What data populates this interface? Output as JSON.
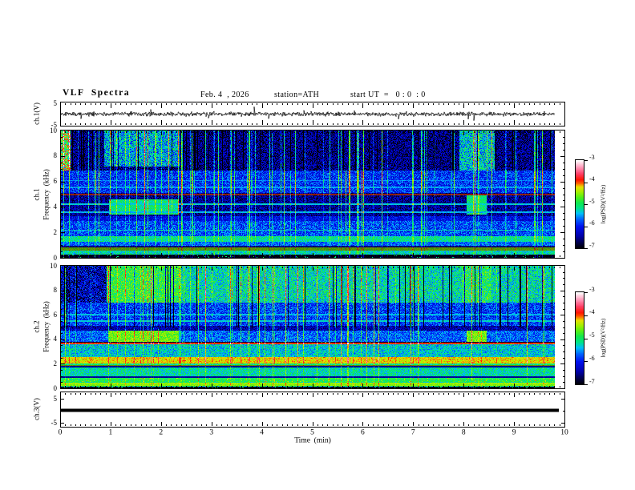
{
  "header": {
    "title": "VLF  Spectra",
    "date": "Feb. 4  , 2026",
    "station": "station=ATH",
    "start_ut": "start UT  =   0 : 0  : 0"
  },
  "x_axis": {
    "label": "Time  (min)",
    "tick_labels": [
      "0",
      "1",
      "2",
      "3",
      "4",
      "5",
      "6",
      "7",
      "8",
      "9",
      "10"
    ],
    "min": 0,
    "max": 10,
    "minor_step": 0.1
  },
  "colorbar": {
    "label": "log(PSD)(V²/Hz)",
    "tick_labels": [
      "-3",
      "-4",
      "-5",
      "-6",
      "-7"
    ],
    "min": -7,
    "max": -3
  },
  "colormap_stops": [
    [
      0,
      "#000000"
    ],
    [
      0.06,
      "#000040"
    ],
    [
      0.14,
      "#0000a8"
    ],
    [
      0.25,
      "#0010f0"
    ],
    [
      0.33,
      "#0060ff"
    ],
    [
      0.4,
      "#00c0f8"
    ],
    [
      0.46,
      "#00e488"
    ],
    [
      0.52,
      "#10e850"
    ],
    [
      0.58,
      "#50f018"
    ],
    [
      0.64,
      "#a0f000"
    ],
    [
      0.7,
      "#e8e000"
    ],
    [
      0.74,
      "#ff6000"
    ],
    [
      0.78,
      "#ff1400"
    ],
    [
      0.85,
      "#ff4068"
    ],
    [
      0.92,
      "#ff98b8"
    ],
    [
      0.97,
      "#ffd8e4"
    ],
    [
      1,
      "#ffffff"
    ]
  ],
  "chart_data": {
    "type": "heatmap",
    "title": "VLF Spectra",
    "x_range_min": [
      0,
      10
    ],
    "data_end_min": 9.8,
    "psd_units": "log(PSD)(V²/Hz)",
    "psd_range": [
      -7,
      -3
    ],
    "panels": [
      {
        "id": "ch1_waveform",
        "kind": "waveform",
        "ylabel": "ch.1(V)",
        "yunits": "V",
        "yrange": [
          -5,
          5
        ],
        "ytick_labels": [
          "5",
          "-5"
        ],
        "signal": {
          "mean": 0,
          "noise_std": 0.45,
          "spike_prob": 0.014,
          "spike_min": 1.1,
          "spike_max": 3.2,
          "spike_neg_frac": 0.7,
          "seed": 20260204,
          "end_min": 9.8
        }
      },
      {
        "id": "ch1_spectrogram",
        "kind": "spectrogram",
        "ylabel_outer": "ch.1",
        "ylabel_inner": "Frequency  (kHz)",
        "yunits": "kHz",
        "yrange": [
          0,
          10
        ],
        "ytick_labels": [
          "10",
          "8",
          "6",
          "4",
          "2",
          "0"
        ],
        "value_range": [
          -7,
          -3
        ],
        "seed": 11,
        "end_min": 9.8,
        "bands": [
          {
            "f": [
              6.9,
              10.01
            ],
            "v": -6.55,
            "n": 0.55
          },
          {
            "f": [
              5.15,
              6.9
            ],
            "v": -5.9,
            "n": 0.45
          },
          {
            "f": [
              3.3,
              5.15
            ],
            "v": -6.5,
            "n": 0.45
          },
          {
            "f": [
              2.95,
              3.3
            ],
            "v": -6.1,
            "n": 0.35
          },
          {
            "f": [
              1.75,
              2.95
            ],
            "v": -5.8,
            "n": 0.45
          },
          {
            "f": [
              1.32,
              1.75
            ],
            "v": -5.15,
            "n": 0.3
          },
          {
            "f": [
              0.95,
              1.32
            ],
            "v": -5.7,
            "n": 0.35
          },
          {
            "f": [
              0.6,
              0.95
            ],
            "v": -4.5,
            "n": 0.2,
            "dim": 0.62
          },
          {
            "f": [
              0.28,
              0.6
            ],
            "v": -5.25,
            "n": 0.35
          },
          {
            "f": [
              0,
              0.28
            ],
            "v": -6.92,
            "n": 0.12,
            "speckle": [
              0.05,
              -5.1
            ]
          }
        ],
        "patches": [
          {
            "t": [
              0,
              0.18
            ],
            "f": [
              6.9,
              10.01
            ],
            "v": -4.6,
            "n": 0.9
          },
          {
            "t": [
              0.85,
              2.35
            ],
            "f": [
              7.2,
              10.01
            ],
            "v": -5.45,
            "n": 0.6
          },
          {
            "t": [
              7.9,
              8.6
            ],
            "f": [
              6.9,
              10.01
            ],
            "v": -5.35,
            "n": 0.6
          },
          {
            "t": [
              0.95,
              2.33
            ],
            "f": [
              3.4,
              4.6
            ],
            "v": -5.1,
            "n": 0.3
          },
          {
            "t": [
              8.05,
              8.45
            ],
            "f": [
              3.4,
              5.0
            ],
            "v": -5.05,
            "n": 0.3
          }
        ],
        "hlines": [
          {
            "f": 5.0,
            "v": -3.95,
            "dim": 0.55
          },
          {
            "f": 4.25,
            "v": -5.35
          },
          {
            "f": 3.62,
            "v": -5.45
          },
          {
            "f": 5.55,
            "v": -5.5
          },
          {
            "f": 6.1,
            "v": -5.55
          },
          {
            "f": 2.2,
            "v": -5.3
          },
          {
            "f": 0.92,
            "v": -6.6
          }
        ],
        "stripes": {
          "bright_p": 0.13,
          "bright_min": 0.5,
          "bright_max": 1.9,
          "dark_p": 0.07,
          "dark_amp": 1.6,
          "dark_fmin": 6.9
        }
      },
      {
        "id": "ch2_spectrogram",
        "kind": "spectrogram",
        "ylabel_outer": "ch.2",
        "ylabel_inner": "Frequency  (kHz)",
        "yunits": "kHz",
        "yrange": [
          0,
          10
        ],
        "ytick_labels": [
          "10",
          "8",
          "6",
          "4",
          "2",
          "0"
        ],
        "value_range": [
          -7,
          -3
        ],
        "seed": 29,
        "end_min": 9.8,
        "bands": [
          {
            "f": [
              7.0,
              10.01
            ],
            "v": -5.2,
            "n": 0.5
          },
          {
            "f": [
              5.15,
              7.0
            ],
            "v": -5.85,
            "n": 0.45
          },
          {
            "f": [
              4.75,
              5.15
            ],
            "v": -6.4,
            "n": 0.4
          },
          {
            "f": [
              3.85,
              4.75
            ],
            "v": -5.7,
            "n": 0.4
          },
          {
            "f": [
              3.6,
              3.78
            ],
            "v": -3.95,
            "n": 0.12
          },
          {
            "f": [
              2.6,
              3.6
            ],
            "v": -5.35,
            "n": 0.4
          },
          {
            "f": [
              2.05,
              2.6
            ],
            "v": -4.25,
            "n": 0.22,
            "speckle": [
              0.05,
              -3.95
            ]
          },
          {
            "f": [
              1.95,
              2.05
            ],
            "v": -5.1,
            "n": 0.3
          },
          {
            "f": [
              1.7,
              1.95
            ],
            "v": -4.45,
            "n": 0.2,
            "dim": 0.6
          },
          {
            "f": [
              0.9,
              1.7
            ],
            "v": -5.2,
            "n": 0.35
          },
          {
            "f": [
              0.55,
              0.9
            ],
            "v": -4.95,
            "n": 0.3,
            "speckle": [
              0.07,
              -4.35
            ]
          },
          {
            "f": [
              0.18,
              0.55
            ],
            "v": -5.05,
            "n": 0.45
          },
          {
            "f": [
              0,
              0.18
            ],
            "v": -6.9,
            "n": 0.15,
            "speckle": [
              0.05,
              -5.0
            ]
          }
        ],
        "patches": [
          {
            "t": [
              0,
              0.9
            ],
            "f": [
              7.0,
              10.01
            ],
            "v": -6.3,
            "n": 0.7
          },
          {
            "t": [
              0.9,
              2.35
            ],
            "f": [
              7.0,
              10.01
            ],
            "v": -4.85,
            "n": 0.45
          },
          {
            "t": [
              7.95,
              8.55
            ],
            "f": [
              7.0,
              10.01
            ],
            "v": -4.95,
            "n": 0.5
          },
          {
            "t": [
              0.95,
              2.33
            ],
            "f": [
              3.85,
              4.75
            ],
            "v": -4.6,
            "n": 0.3
          },
          {
            "t": [
              8.05,
              8.45
            ],
            "f": [
              3.85,
              4.75
            ],
            "v": -4.6,
            "n": 0.3
          }
        ],
        "hlines": [
          {
            "f": 1.82,
            "v": -6.2,
            "dim": 0.7
          },
          {
            "f": 0.97,
            "v": -6.3,
            "dim": 0.8
          },
          {
            "f": 5.5,
            "v": -5.3
          },
          {
            "f": 6.05,
            "v": -5.4
          },
          {
            "f": 0.45,
            "v": -4.45
          },
          {
            "f": 0.3,
            "v": -4.55
          }
        ],
        "stripes": {
          "bright_p": 0.11,
          "bright_min": 0.4,
          "bright_max": 1.5,
          "dark_p": 0.1,
          "dark_amp": 1.7,
          "dark_fmin": 5.0
        }
      },
      {
        "id": "ch3_waveform",
        "kind": "flatline",
        "ylabel": "ch.3(V)",
        "yunits": "V",
        "yrange": [
          -5,
          5
        ],
        "ytick_labels": [
          "5",
          "-5"
        ],
        "signal": {
          "value": 0,
          "end_min": 9.88
        }
      }
    ]
  }
}
